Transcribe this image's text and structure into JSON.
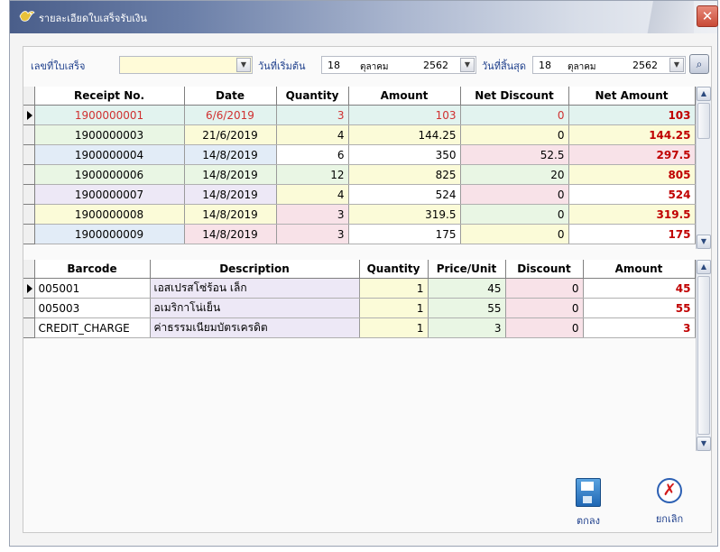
{
  "window": {
    "title": "รายละเอียดใบเสร็จรับเงิน",
    "close": "✕"
  },
  "filter": {
    "receipt_label": "เลขที่ใบเสร็จ",
    "receipt_value": "",
    "start_label": "วันที่เริ่มต้น",
    "start": {
      "day": "18",
      "month": "ตุลาคม",
      "year": "2562"
    },
    "end_label": "วันที่สิ้นสุด",
    "end": {
      "day": "18",
      "month": "ตุลาคม",
      "year": "2562"
    },
    "dropdown_glyph": "▼",
    "search_glyph": "⌕"
  },
  "receipts": {
    "headers": [
      "Receipt No.",
      "Date",
      "Quantity",
      "Amount",
      "Net Discount",
      "Net Amount"
    ],
    "rows": [
      {
        "no": "1900000001",
        "date": "6/6/2019",
        "qty": "3",
        "amount": "103",
        "discount": "0",
        "net": "103"
      },
      {
        "no": "1900000003",
        "date": "21/6/2019",
        "qty": "4",
        "amount": "144.25",
        "discount": "0",
        "net": "144.25"
      },
      {
        "no": "1900000004",
        "date": "14/8/2019",
        "qty": "6",
        "amount": "350",
        "discount": "52.5",
        "net": "297.5"
      },
      {
        "no": "1900000006",
        "date": "14/8/2019",
        "qty": "12",
        "amount": "825",
        "discount": "20",
        "net": "805"
      },
      {
        "no": "1900000007",
        "date": "14/8/2019",
        "qty": "4",
        "amount": "524",
        "discount": "0",
        "net": "524"
      },
      {
        "no": "1900000008",
        "date": "14/8/2019",
        "qty": "3",
        "amount": "319.5",
        "discount": "0",
        "net": "319.5"
      },
      {
        "no": "1900000009",
        "date": "14/8/2019",
        "qty": "3",
        "amount": "175",
        "discount": "0",
        "net": "175"
      }
    ]
  },
  "items": {
    "headers": [
      "Barcode",
      "Description",
      "Quantity",
      "Price/Unit",
      "Discount",
      "Amount"
    ],
    "rows": [
      {
        "barcode": "005001",
        "desc": "เอสเปรสโซ่ร้อน เล็ก",
        "qty": "1",
        "price": "45",
        "discount": "0",
        "amount": "45"
      },
      {
        "barcode": "005003",
        "desc": "อเมริกาโน่เย็น",
        "qty": "1",
        "price": "55",
        "discount": "0",
        "amount": "55"
      },
      {
        "barcode": "CREDIT_CHARGE",
        "desc": "ค่าธรรมเนียมบัตรเครดิต",
        "qty": "1",
        "price": "3",
        "discount": "0",
        "amount": "3"
      }
    ]
  },
  "actions": {
    "ok_label": "ตกลง",
    "cancel_label": "ยกเลิก"
  },
  "colors": {
    "row_green": "#e9f6e4",
    "row_yellow": "#fbfbd8",
    "row_blue": "#e2ecf7",
    "row_pink": "#f8e2e8",
    "row_lavender": "#ede8f6",
    "row_white": "#ffffff",
    "row_teal": "#e2f3ef",
    "selected_text": "#d03030",
    "net_amount": "#c00000"
  }
}
